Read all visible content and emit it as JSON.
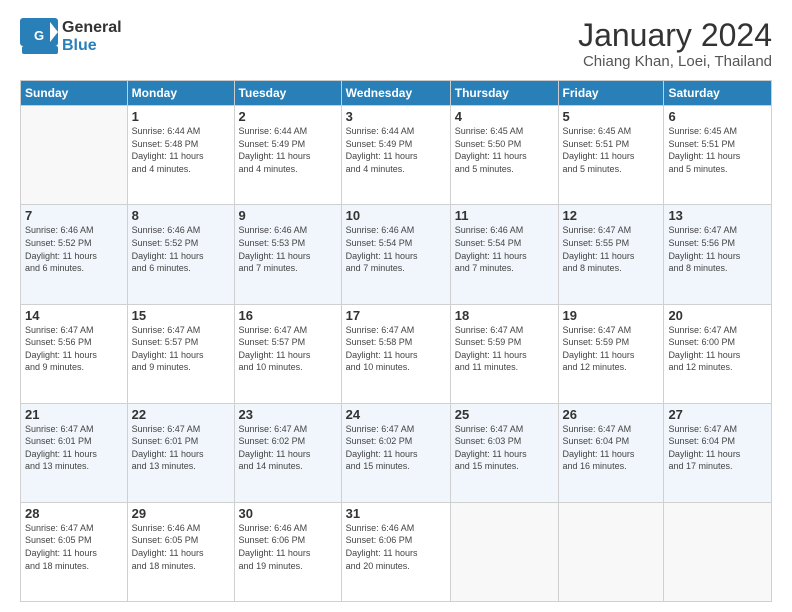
{
  "logo": {
    "general": "General",
    "blue": "Blue",
    "icon": "▶"
  },
  "title": "January 2024",
  "location": "Chiang Khan, Loei, Thailand",
  "weekdays": [
    "Sunday",
    "Monday",
    "Tuesday",
    "Wednesday",
    "Thursday",
    "Friday",
    "Saturday"
  ],
  "weeks": [
    [
      {
        "day": "",
        "info": ""
      },
      {
        "day": "1",
        "info": "Sunrise: 6:44 AM\nSunset: 5:48 PM\nDaylight: 11 hours\nand 4 minutes."
      },
      {
        "day": "2",
        "info": "Sunrise: 6:44 AM\nSunset: 5:49 PM\nDaylight: 11 hours\nand 4 minutes."
      },
      {
        "day": "3",
        "info": "Sunrise: 6:44 AM\nSunset: 5:49 PM\nDaylight: 11 hours\nand 4 minutes."
      },
      {
        "day": "4",
        "info": "Sunrise: 6:45 AM\nSunset: 5:50 PM\nDaylight: 11 hours\nand 5 minutes."
      },
      {
        "day": "5",
        "info": "Sunrise: 6:45 AM\nSunset: 5:51 PM\nDaylight: 11 hours\nand 5 minutes."
      },
      {
        "day": "6",
        "info": "Sunrise: 6:45 AM\nSunset: 5:51 PM\nDaylight: 11 hours\nand 5 minutes."
      }
    ],
    [
      {
        "day": "7",
        "info": "Sunrise: 6:46 AM\nSunset: 5:52 PM\nDaylight: 11 hours\nand 6 minutes."
      },
      {
        "day": "8",
        "info": "Sunrise: 6:46 AM\nSunset: 5:52 PM\nDaylight: 11 hours\nand 6 minutes."
      },
      {
        "day": "9",
        "info": "Sunrise: 6:46 AM\nSunset: 5:53 PM\nDaylight: 11 hours\nand 7 minutes."
      },
      {
        "day": "10",
        "info": "Sunrise: 6:46 AM\nSunset: 5:54 PM\nDaylight: 11 hours\nand 7 minutes."
      },
      {
        "day": "11",
        "info": "Sunrise: 6:46 AM\nSunset: 5:54 PM\nDaylight: 11 hours\nand 7 minutes."
      },
      {
        "day": "12",
        "info": "Sunrise: 6:47 AM\nSunset: 5:55 PM\nDaylight: 11 hours\nand 8 minutes."
      },
      {
        "day": "13",
        "info": "Sunrise: 6:47 AM\nSunset: 5:56 PM\nDaylight: 11 hours\nand 8 minutes."
      }
    ],
    [
      {
        "day": "14",
        "info": "Sunrise: 6:47 AM\nSunset: 5:56 PM\nDaylight: 11 hours\nand 9 minutes."
      },
      {
        "day": "15",
        "info": "Sunrise: 6:47 AM\nSunset: 5:57 PM\nDaylight: 11 hours\nand 9 minutes."
      },
      {
        "day": "16",
        "info": "Sunrise: 6:47 AM\nSunset: 5:57 PM\nDaylight: 11 hours\nand 10 minutes."
      },
      {
        "day": "17",
        "info": "Sunrise: 6:47 AM\nSunset: 5:58 PM\nDaylight: 11 hours\nand 10 minutes."
      },
      {
        "day": "18",
        "info": "Sunrise: 6:47 AM\nSunset: 5:59 PM\nDaylight: 11 hours\nand 11 minutes."
      },
      {
        "day": "19",
        "info": "Sunrise: 6:47 AM\nSunset: 5:59 PM\nDaylight: 11 hours\nand 12 minutes."
      },
      {
        "day": "20",
        "info": "Sunrise: 6:47 AM\nSunset: 6:00 PM\nDaylight: 11 hours\nand 12 minutes."
      }
    ],
    [
      {
        "day": "21",
        "info": "Sunrise: 6:47 AM\nSunset: 6:01 PM\nDaylight: 11 hours\nand 13 minutes."
      },
      {
        "day": "22",
        "info": "Sunrise: 6:47 AM\nSunset: 6:01 PM\nDaylight: 11 hours\nand 13 minutes."
      },
      {
        "day": "23",
        "info": "Sunrise: 6:47 AM\nSunset: 6:02 PM\nDaylight: 11 hours\nand 14 minutes."
      },
      {
        "day": "24",
        "info": "Sunrise: 6:47 AM\nSunset: 6:02 PM\nDaylight: 11 hours\nand 15 minutes."
      },
      {
        "day": "25",
        "info": "Sunrise: 6:47 AM\nSunset: 6:03 PM\nDaylight: 11 hours\nand 15 minutes."
      },
      {
        "day": "26",
        "info": "Sunrise: 6:47 AM\nSunset: 6:04 PM\nDaylight: 11 hours\nand 16 minutes."
      },
      {
        "day": "27",
        "info": "Sunrise: 6:47 AM\nSunset: 6:04 PM\nDaylight: 11 hours\nand 17 minutes."
      }
    ],
    [
      {
        "day": "28",
        "info": "Sunrise: 6:47 AM\nSunset: 6:05 PM\nDaylight: 11 hours\nand 18 minutes."
      },
      {
        "day": "29",
        "info": "Sunrise: 6:46 AM\nSunset: 6:05 PM\nDaylight: 11 hours\nand 18 minutes."
      },
      {
        "day": "30",
        "info": "Sunrise: 6:46 AM\nSunset: 6:06 PM\nDaylight: 11 hours\nand 19 minutes."
      },
      {
        "day": "31",
        "info": "Sunrise: 6:46 AM\nSunset: 6:06 PM\nDaylight: 11 hours\nand 20 minutes."
      },
      {
        "day": "",
        "info": ""
      },
      {
        "day": "",
        "info": ""
      },
      {
        "day": "",
        "info": ""
      }
    ]
  ]
}
